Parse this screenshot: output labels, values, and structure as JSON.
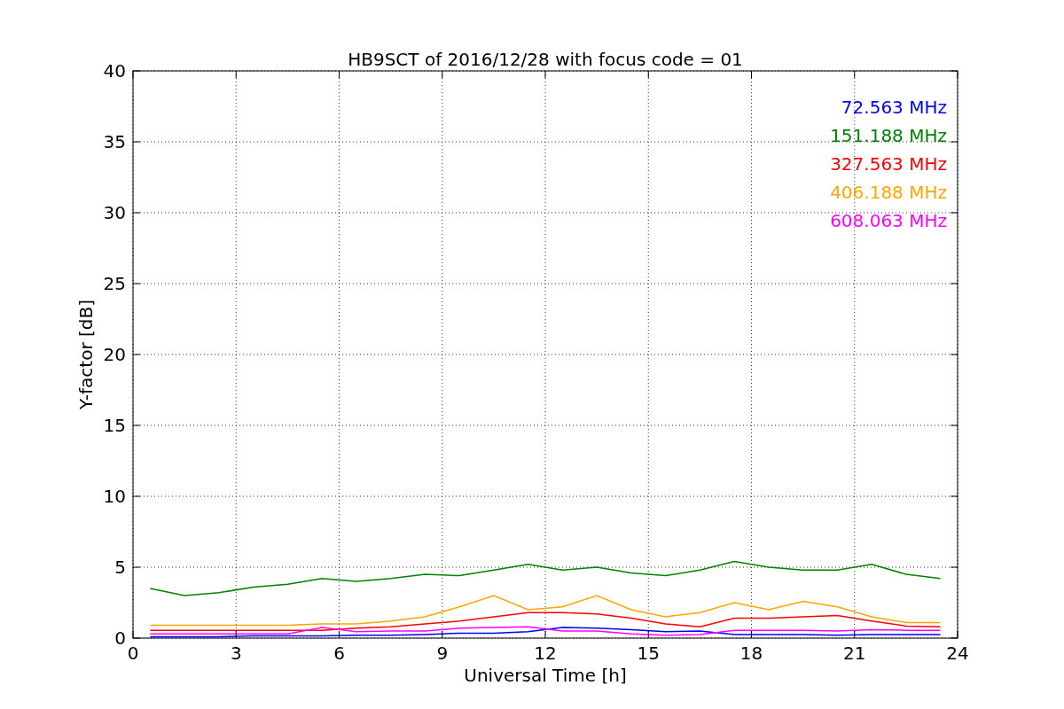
{
  "figure": {
    "chart_data": {
      "type": "line",
      "title": "HB9SCT of 2016/12/28 with focus code = 01",
      "xlabel": "Universal Time [h]",
      "ylabel": "Y-factor [dB]",
      "x": [
        0.5,
        1.5,
        2.5,
        3.5,
        4.5,
        5.5,
        6.5,
        7.5,
        8.5,
        9.5,
        10.5,
        11.5,
        12.5,
        13.5,
        14.5,
        15.5,
        16.5,
        17.5,
        18.5,
        19.5,
        20.5,
        21.5,
        22.5,
        23.5
      ],
      "xlim": [
        0,
        24
      ],
      "ylim": [
        0,
        40
      ],
      "grid": true,
      "xticks": [
        0,
        3,
        6,
        9,
        12,
        15,
        18,
        21,
        24
      ],
      "yticks": [
        0,
        5,
        10,
        15,
        20,
        25,
        30,
        35,
        40
      ],
      "series": [
        {
          "name": "72.563 MHz",
          "color": "#0000ff",
          "values": [
            0.1,
            0.1,
            0.1,
            0.15,
            0.15,
            0.15,
            0.2,
            0.2,
            0.25,
            0.35,
            0.35,
            0.45,
            0.75,
            0.7,
            0.6,
            0.45,
            0.5,
            0.25,
            0.25,
            0.25,
            0.2,
            0.25,
            0.25,
            0.25
          ]
        },
        {
          "name": "151.188 MHz",
          "color": "#008000",
          "values": [
            3.5,
            3.0,
            3.2,
            3.6,
            3.8,
            4.2,
            4.0,
            4.2,
            4.5,
            4.4,
            4.8,
            5.2,
            4.8,
            5.0,
            4.6,
            4.4,
            4.8,
            5.4,
            5.0,
            4.8,
            4.8,
            5.2,
            4.5,
            4.2
          ]
        },
        {
          "name": "327.563 MHz",
          "color": "#ff0000",
          "values": [
            0.55,
            0.55,
            0.55,
            0.55,
            0.55,
            0.55,
            0.7,
            0.8,
            1.0,
            1.2,
            1.5,
            1.8,
            1.8,
            1.7,
            1.4,
            1.0,
            0.8,
            1.4,
            1.4,
            1.5,
            1.6,
            1.2,
            0.85,
            0.8
          ]
        },
        {
          "name": "406.188 MHz",
          "color": "#ffa500",
          "values": [
            0.9,
            0.9,
            0.9,
            0.9,
            0.9,
            1.0,
            1.0,
            1.2,
            1.5,
            2.2,
            3.0,
            2.0,
            2.2,
            3.0,
            2.0,
            1.5,
            1.8,
            2.5,
            2.0,
            2.6,
            2.2,
            1.5,
            1.1,
            1.1
          ]
        },
        {
          "name": "608.063 MHz",
          "color": "#ff00ff",
          "values": [
            0.3,
            0.3,
            0.3,
            0.3,
            0.3,
            0.75,
            0.45,
            0.5,
            0.5,
            0.7,
            0.75,
            0.8,
            0.5,
            0.5,
            0.3,
            0.2,
            0.25,
            0.55,
            0.55,
            0.55,
            0.5,
            0.6,
            0.55,
            0.55
          ]
        }
      ]
    }
  }
}
